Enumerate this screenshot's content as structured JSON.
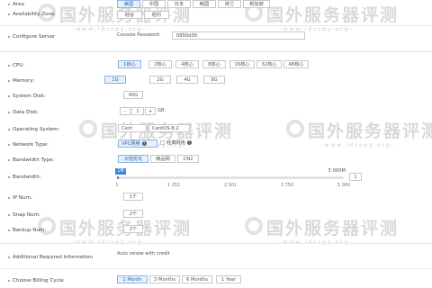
{
  "labels": {
    "area": "Area",
    "zone": "Availability Zone",
    "server": "Configure Server",
    "cpu": "CPU:",
    "memory": "Memory:",
    "system_disk": "System Disk:",
    "data_disk": "Data Disk:",
    "os": "Operating System:",
    "network": "Network Type:",
    "bandwidth_type": "Bandwidth Type:",
    "bandwidth": "Bandwidth:",
    "ip": "IP Num:",
    "snap": "Snap Num:",
    "backup": "Backup Num:",
    "additional": "Additional Required Information",
    "billing": "Choose Billing Cycle"
  },
  "area_options": [
    "美国",
    "中国",
    "日本",
    "韩国",
    "荷兰",
    "新加坡"
  ],
  "area_selected": "美国",
  "zone_options": [
    "硅谷",
    "纽约"
  ],
  "console_password_label": "Console Password:",
  "console_password_value": "0950d30",
  "cpu_options": [
    "1核心",
    "2核心",
    "4核心",
    "8核心",
    "16核心",
    "32核心",
    "48核心"
  ],
  "cpu_selected": "1核心",
  "memory_options": [
    "1G",
    "2G",
    "4G",
    "8G"
  ],
  "memory_selected": "1G",
  "system_disk": "40G",
  "data_disk": {
    "minus": "-",
    "value": "1",
    "plus": "+",
    "unit": "GB"
  },
  "os": {
    "family": "Cent",
    "version": "CentOS-8.2"
  },
  "network_options": [
    "VPC网络",
    "经典网络"
  ],
  "network_selected": "VPC网络",
  "network_help": "?",
  "bandwidth_type_options": [
    "大陆优化",
    "精品网",
    "CN2"
  ],
  "bandwidth_type_selected": "大陆优化",
  "bandwidth": {
    "value_badge": "1M",
    "max_label": "5 000M",
    "input_value": "1",
    "ticks": [
      "1",
      "1 251",
      "2 501",
      "3 750",
      "5 000"
    ],
    "fraction": 0.0
  },
  "ip_num": "1个",
  "snap_num": "2个",
  "backup_num": "2个",
  "additional_text": "Auto renew with credit",
  "billing_options": [
    "1 Month",
    "3 Months",
    "6 Months",
    "1 Year"
  ],
  "billing_selected": "1 Month",
  "watermark": {
    "text": "国外服务器评测",
    "url": "-www.idcspy.org-"
  }
}
